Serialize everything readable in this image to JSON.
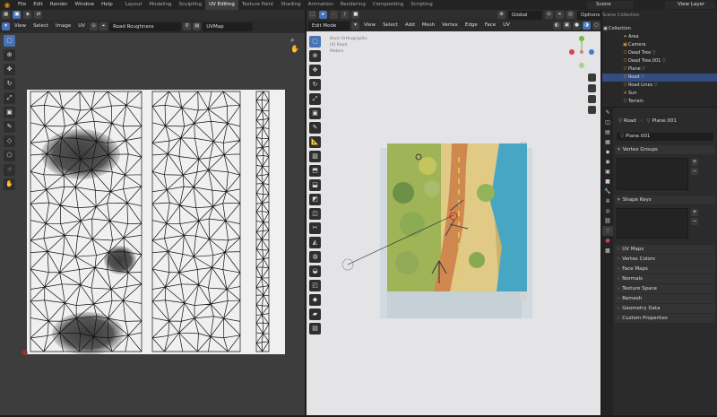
{
  "topbar": {
    "menus": [
      "File",
      "Edit",
      "Render",
      "Window",
      "Help"
    ],
    "workspaces": [
      "Layout",
      "Modeling",
      "Sculpting",
      "UV Editing",
      "Texture Paint",
      "Shading",
      "Animation",
      "Rendering",
      "Compositing",
      "Scripting"
    ],
    "active_workspace": "UV Editing",
    "scene": "Scene",
    "view_layer": "View Layer"
  },
  "uv_editor": {
    "menus": [
      "View",
      "Select",
      "Image",
      "UV"
    ],
    "image_name": "Road Roughness",
    "uv_map": "UVMap"
  },
  "viewport": {
    "mode": "Edit Mode",
    "menus": [
      "View",
      "Select",
      "Add",
      "Mesh",
      "Vertex",
      "Edge",
      "Face",
      "UV"
    ],
    "orientation": "Global",
    "options_label": "Options",
    "info_lines": [
      "Back Orthographic",
      "(0) Road",
      "Meters"
    ]
  },
  "outliner": {
    "header": "Scene Collection",
    "collection": "Collection",
    "items": [
      {
        "name": "Area",
        "selected": false
      },
      {
        "name": "Camera",
        "selected": false
      },
      {
        "name": "Dead Tree",
        "selected": false
      },
      {
        "name": "Dead Tree.001",
        "selected": false
      },
      {
        "name": "Plane",
        "selected": false
      },
      {
        "name": "Road",
        "selected": true
      },
      {
        "name": "Road Lines",
        "selected": false
      },
      {
        "name": "Sun",
        "selected": false
      },
      {
        "name": "Terrain",
        "selected": false
      }
    ]
  },
  "properties": {
    "breadcrumb_object": "Road",
    "breadcrumb_mesh": "Plane.001",
    "mesh_name": "Plane.001",
    "panels": [
      "Vertex Groups",
      "Shape Keys",
      "UV Maps",
      "Vertex Colors",
      "Face Maps",
      "Normals",
      "Texture Space",
      "Remesh",
      "Geometry Data",
      "Custom Properties"
    ]
  },
  "colors": {
    "accent": "#4772b3",
    "selection": "#334d80",
    "viewport_bg": "#e4e4e6",
    "uv_bg": "#3d3d3d"
  }
}
